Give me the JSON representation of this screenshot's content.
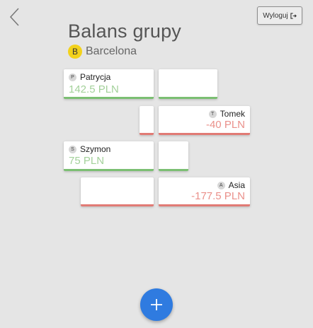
{
  "header": {
    "back_icon": "chevron-left-icon",
    "logout_label": "Wyloguj",
    "logout_icon": "logout-icon"
  },
  "page": {
    "title": "Balans grupy"
  },
  "group": {
    "initial": "B",
    "name": "Barcelona",
    "badge_color": "#f3d21b"
  },
  "members": [
    {
      "initial": "P",
      "name": "Patrycja",
      "amount": "142.5 PLN",
      "balance": 142.5
    },
    {
      "initial": "T",
      "name": "Tomek",
      "amount": "-40 PLN",
      "balance": -40
    },
    {
      "initial": "S",
      "name": "Szymon",
      "amount": "75 PLN",
      "balance": 75
    },
    {
      "initial": "A",
      "name": "Asia",
      "amount": "-177.5 PLN",
      "balance": -177.5
    }
  ],
  "colors": {
    "positive": "#7bbf72",
    "negative": "#e17b75",
    "fab": "#2f7be0"
  },
  "fab": {
    "icon": "plus-icon"
  }
}
